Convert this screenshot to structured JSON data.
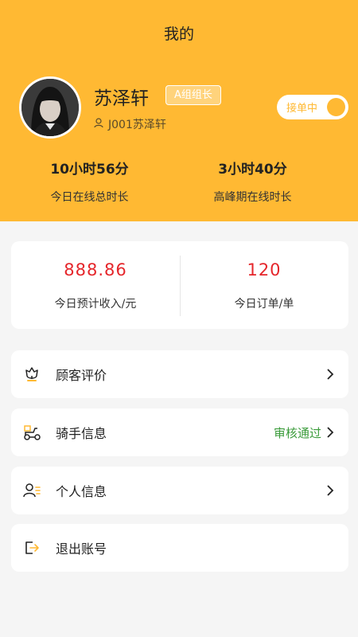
{
  "page": {
    "title": "我的"
  },
  "profile": {
    "name": "苏泽轩",
    "role_badge": "A组组长",
    "user_id": "J001苏泽轩",
    "status_toggle": {
      "label": "接单中",
      "on": true
    }
  },
  "stats": {
    "online_total": {
      "value": "10小时56分",
      "label": "今日在线总时长"
    },
    "peak_online": {
      "value": "3小时40分",
      "label": "高峰期在线时长"
    }
  },
  "income": {
    "expected_income": {
      "value": "888.86",
      "label": "今日预计收入/元"
    },
    "orders": {
      "value": "120",
      "label": "今日订单/单"
    }
  },
  "menu": {
    "reviews": {
      "label": "顾客评价",
      "icon": "flower-icon"
    },
    "rider_info": {
      "label": "骑手信息",
      "status": "审核通过",
      "icon": "scooter-icon"
    },
    "personal_info": {
      "label": "个人信息",
      "icon": "person-list-icon"
    },
    "logout": {
      "label": "退出账号",
      "icon": "exit-icon"
    }
  },
  "colors": {
    "brand": "#ffb933",
    "income_text": "#e5262b",
    "approved": "#3a9b3a"
  }
}
